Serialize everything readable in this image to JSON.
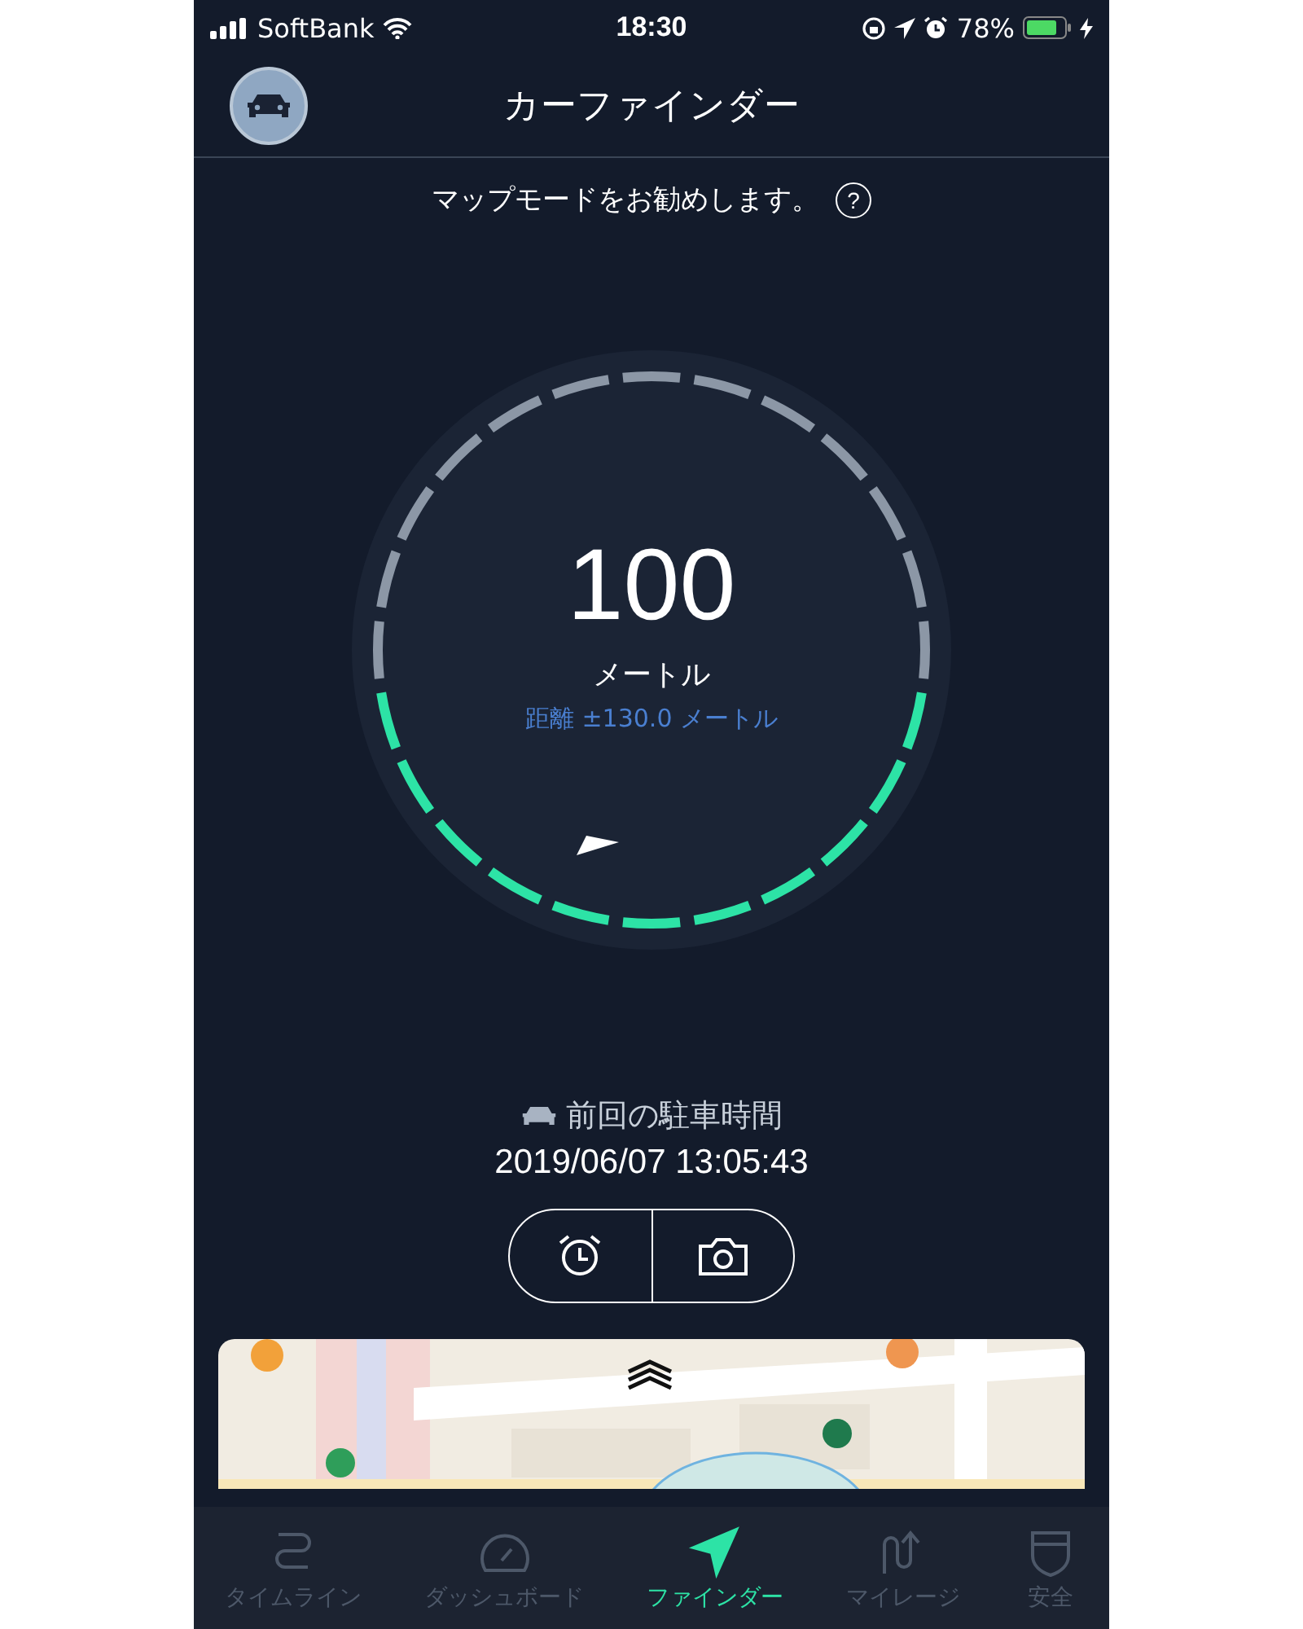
{
  "status_bar": {
    "carrier": "SoftBank",
    "time": "18:30",
    "battery": "78%"
  },
  "header": {
    "title": "カーファインダー"
  },
  "hint": {
    "text": "マップモードをお勧めします。",
    "help": "?"
  },
  "gauge": {
    "distance": "100",
    "unit": "メートル",
    "accuracy": "距離 ±130.0 メートル"
  },
  "parking": {
    "label": "前回の駐車時間",
    "time": "2019/06/07 13:05:43"
  },
  "tabs": [
    {
      "label": "タイムライン",
      "kind": "timeline",
      "selected": false
    },
    {
      "label": "ダッシュボード",
      "kind": "dashboard",
      "selected": false
    },
    {
      "label": "ファインダー",
      "kind": "finder",
      "selected": true
    },
    {
      "label": "マイレージ",
      "kind": "mileage",
      "selected": false
    },
    {
      "label": "安全",
      "kind": "safety",
      "selected": false
    }
  ]
}
